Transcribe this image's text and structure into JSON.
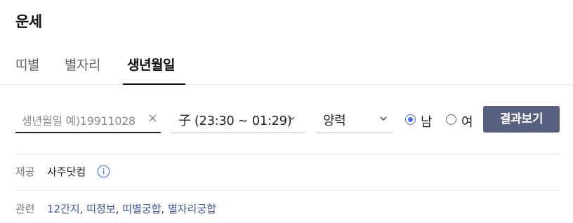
{
  "page": {
    "title": "운세"
  },
  "tabs": [
    {
      "label": "띠별"
    },
    {
      "label": "별자리"
    },
    {
      "label": "생년월일",
      "active": true
    }
  ],
  "form": {
    "birth_placeholder": "생년월일 예)19911028",
    "clear_icon": "×",
    "time_select": {
      "value": "子 (23:30 ~ 01:29)"
    },
    "calendar_select": {
      "value": "양력"
    },
    "gender": [
      {
        "label": "남",
        "checked": true
      },
      {
        "label": "여",
        "checked": false
      }
    ],
    "submit_label": "결과보기"
  },
  "provider": {
    "key": "제공",
    "name": "사주닷컴",
    "icon": "info-icon"
  },
  "related": {
    "key": "관련",
    "links": [
      "12간지",
      "띠정보",
      "띠별궁합",
      "별자리궁합"
    ],
    "separator": ", "
  },
  "colors": {
    "accent": "#4a6cf7",
    "button": "#586180",
    "link": "#3c55b0"
  }
}
